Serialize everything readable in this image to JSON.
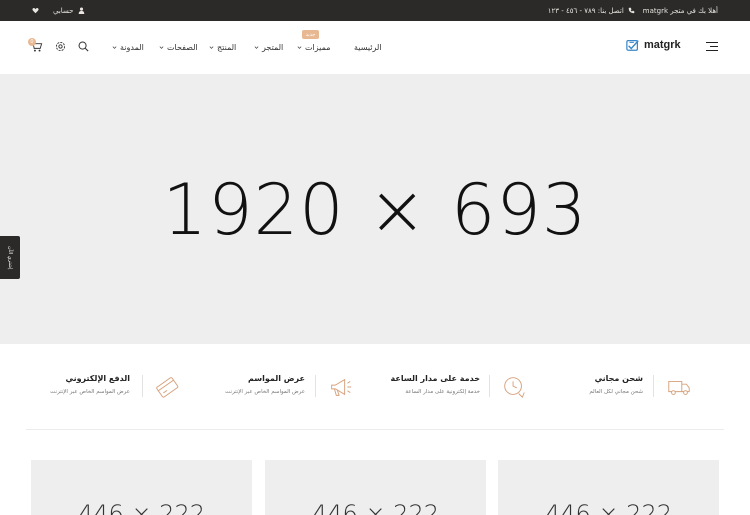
{
  "topbar": {
    "welcome": "أهلا بك في متجر matgrk",
    "contact": "اتصل بنا: ٧٨٩ - ٤٥٦ - ١٢٣",
    "account": "حسابي"
  },
  "header": {
    "logo_text": "matgrk",
    "nav": [
      {
        "label": "الرئيسية",
        "dropdown": false
      },
      {
        "label": "مميزات",
        "dropdown": true,
        "badge": "جديد"
      },
      {
        "label": "المتجر",
        "dropdown": true
      },
      {
        "label": "المنتج",
        "dropdown": true
      },
      {
        "label": "الصفحات",
        "dropdown": true
      },
      {
        "label": "المدونة",
        "dropdown": true
      }
    ],
    "cart_count": "0"
  },
  "hero": {
    "placeholder": "1920 × 693"
  },
  "side_tab": {
    "label": "إشتري الآن"
  },
  "features": [
    {
      "title": "شحن مجاني",
      "subtitle": "شحن مجاني لكل العالم",
      "icon": "truck-icon"
    },
    {
      "title": "خدمة على مدار الساعة",
      "subtitle": "خدمة إلكترونية على مدار الساعة",
      "icon": "clock-icon"
    },
    {
      "title": "عرض المواسم",
      "subtitle": "عرض المواسم الخاص عبر الإنترنت",
      "icon": "megaphone-icon"
    },
    {
      "title": "الدفع الإلكتروني",
      "subtitle": "عرض المواسم الخاص عبر الإنترنت",
      "icon": "credit-card-icon"
    }
  ],
  "cards": [
    {
      "placeholder": "446 × 222"
    },
    {
      "placeholder": "446 × 222"
    },
    {
      "placeholder": "446 × 222"
    }
  ],
  "colors": {
    "topbar_bg": "#2b2a28",
    "accent": "#e8b893",
    "placeholder_bg": "#eeeeee"
  }
}
